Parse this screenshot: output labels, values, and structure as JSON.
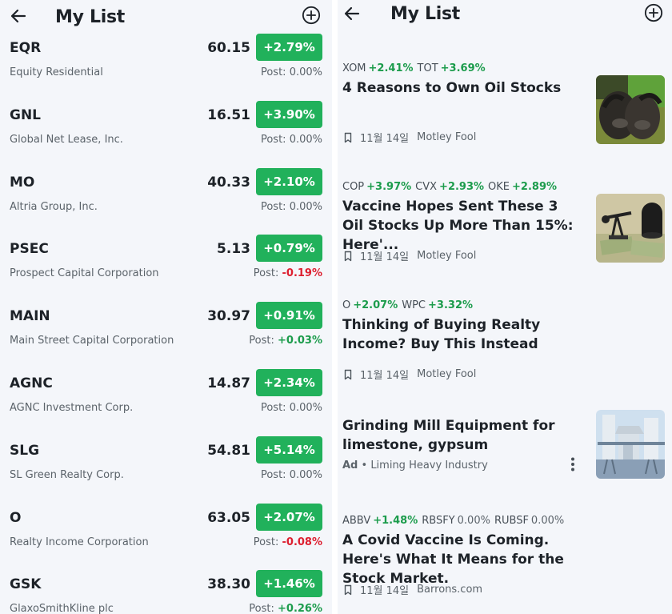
{
  "left": {
    "title": "My List",
    "stocks": [
      {
        "symbol": "EQR",
        "price": "60.15",
        "change": "+2.79%",
        "name": "Equity Residential",
        "post_label": "Post:",
        "post_value": "0.00%",
        "post_dir": "neutral"
      },
      {
        "symbol": "GNL",
        "price": "16.51",
        "change": "+3.90%",
        "name": "Global Net Lease, Inc.",
        "post_label": "Post:",
        "post_value": "0.00%",
        "post_dir": "neutral"
      },
      {
        "symbol": "MO",
        "price": "40.33",
        "change": "+2.10%",
        "name": "Altria Group, Inc.",
        "post_label": "Post:",
        "post_value": "0.00%",
        "post_dir": "neutral"
      },
      {
        "symbol": "PSEC",
        "price": "5.13",
        "change": "+0.79%",
        "name": "Prospect Capital Corporation",
        "post_label": "Post:",
        "post_value": "-0.19%",
        "post_dir": "neg"
      },
      {
        "symbol": "MAIN",
        "price": "30.97",
        "change": "+0.91%",
        "name": "Main Street Capital Corporation",
        "post_label": "Post:",
        "post_value": "+0.03%",
        "post_dir": "pos"
      },
      {
        "symbol": "AGNC",
        "price": "14.87",
        "change": "+2.34%",
        "name": "AGNC Investment Corp.",
        "post_label": "Post:",
        "post_value": "0.00%",
        "post_dir": "neutral"
      },
      {
        "symbol": "SLG",
        "price": "54.81",
        "change": "+5.14%",
        "name": "SL Green Realty Corp.",
        "post_label": "Post:",
        "post_value": "0.00%",
        "post_dir": "neutral"
      },
      {
        "symbol": "O",
        "price": "63.05",
        "change": "+2.07%",
        "name": "Realty Income Corporation",
        "post_label": "Post:",
        "post_value": "-0.08%",
        "post_dir": "neg"
      },
      {
        "symbol": "GSK",
        "price": "38.30",
        "change": "+1.46%",
        "name": "GlaxoSmithKline plc",
        "post_label": "Post:",
        "post_value": "+0.26%",
        "post_dir": "pos"
      }
    ]
  },
  "right": {
    "title": "My List",
    "news": [
      {
        "tickers": [
          {
            "sym": "XOM",
            "chg": "+2.41%",
            "dir": "pos"
          },
          {
            "sym": "TOT",
            "chg": "+3.69%",
            "dir": "pos"
          }
        ],
        "headline": "4 Reasons to Own Oil Stocks",
        "date": "11월 14일",
        "source": "Motley Fool",
        "thumb_icon": "oily-hands-photo"
      },
      {
        "tickers": [
          {
            "sym": "COP",
            "chg": "+3.97%",
            "dir": "pos"
          },
          {
            "sym": "CVX",
            "chg": "+2.93%",
            "dir": "pos"
          },
          {
            "sym": "OKE",
            "chg": "+2.89%",
            "dir": "pos"
          }
        ],
        "headline": "Vaccine Hopes Sent These 3 Oil Stocks Up More Than 15%: Here'...",
        "date": "11월 14일",
        "source": "Motley Fool",
        "thumb_icon": "oil-pump-money-photo"
      },
      {
        "tickers": [
          {
            "sym": "O",
            "chg": "+2.07%",
            "dir": "pos"
          },
          {
            "sym": "WPC",
            "chg": "+3.32%",
            "dir": "pos"
          }
        ],
        "headline": "Thinking of Buying Realty Income? Buy This Instead",
        "date": "11월 14일",
        "source": "Motley Fool"
      },
      {
        "ad": true,
        "headline": "Grinding Mill Equipment for limestone, gypsum",
        "ad_label": "Ad",
        "separator": "•",
        "source": "Liming Heavy Industry",
        "thumb_icon": "grinding-mill-photo"
      },
      {
        "tickers": [
          {
            "sym": "ABBV",
            "chg": "+1.48%",
            "dir": "pos"
          },
          {
            "sym": "RBSFY",
            "chg": "0.00%",
            "dir": "flat"
          },
          {
            "sym": "RUBSF",
            "chg": "0.00%",
            "dir": "flat"
          }
        ],
        "headline": "A Covid Vaccine Is Coming. Here's What It Means for the Stock Market.",
        "date": "11월 14일",
        "source": "Barrons.com"
      }
    ]
  },
  "colors": {
    "badge_green": "#21b15b",
    "positive": "#1c9c4c",
    "negative": "#dd1f2f",
    "background": "#f4f6fa"
  }
}
